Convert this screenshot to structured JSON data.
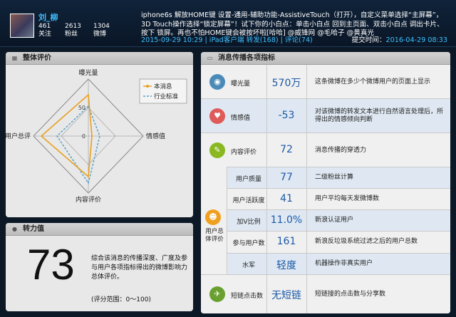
{
  "user": {
    "name": "刘_柳",
    "stats": [
      {
        "num": "461",
        "label": "关注"
      },
      {
        "num": "2613",
        "label": "粉丝"
      },
      {
        "num": "1304",
        "label": "微博"
      }
    ]
  },
  "post": {
    "text": "iphone6s 解放HOME键 设置-通用-辅助功能-AssistiveTouch（打开），自定义菜单选择“主屏幕”，3D Touch操作选择“锁定屏幕”！试下你的小白点：单击小白点 回到主页面、双击小白点 调出卡片、按下 锁屏。再也不怕HOME键会被按坏啦[哈哈] @威锋网 @毛哈子 @黄真光",
    "meta": "2015-09-29 10:29 | iPad客户端    转发(168) | 评论(74)",
    "submit_label": "提交时间：",
    "submit_time": "2016-04-29 08:33"
  },
  "radar": {
    "title": "整体评价",
    "legend": [
      "本消息",
      "行业标准"
    ],
    "axes": [
      "曝光量",
      "情感值",
      "内容评价",
      "用户总评"
    ],
    "ticks": [
      "50",
      "0"
    ],
    "icon": "chart-icon",
    "colors": {
      "msg": "#e8a020",
      "std": "#5aa0c8"
    }
  },
  "power": {
    "title": "转力值",
    "icon": "user-icon",
    "value": "73",
    "desc": "综合该消息的传播深度、广度及参与用户各项指标得出的微博影响力总体评价。",
    "range": "(评分范围：0～100)"
  },
  "table": {
    "title": "消息传播各项指标",
    "icon": "monitor-icon",
    "group_label": "用户总体评价",
    "rows": [
      {
        "label": "曝光量",
        "value": "570万",
        "desc": "这条微博在多少个微博用户的页面上显示",
        "icon": "camera-icon"
      },
      {
        "label": "情感值",
        "value": "-53",
        "desc": "对该微博的转发文本进行自然语言处理后，所得出的情感倾向判断",
        "icon": "heart-icon"
      },
      {
        "label": "内容评价",
        "value": "72",
        "desc": "消息传播的穿透力",
        "icon": "chat-icon"
      },
      {
        "label": "用户质量",
        "value": "77",
        "desc": "二级粉丝计算"
      },
      {
        "label": "用户活跃度",
        "value": "41",
        "desc": "用户平均每天发微博数"
      },
      {
        "label": "加V比例",
        "value": "11.0%",
        "desc": "新浪认证用户"
      },
      {
        "label": "参与用户数",
        "value": "161",
        "desc": "新浪反垃圾系统过滤之后的用户总数"
      },
      {
        "label": "水军",
        "value": "轻度",
        "desc": "机器操作非真实用户"
      },
      {
        "label": "短链点击数",
        "value": "无短链",
        "desc": "短链接的点击数与分享数",
        "icon": "link-icon"
      }
    ]
  }
}
